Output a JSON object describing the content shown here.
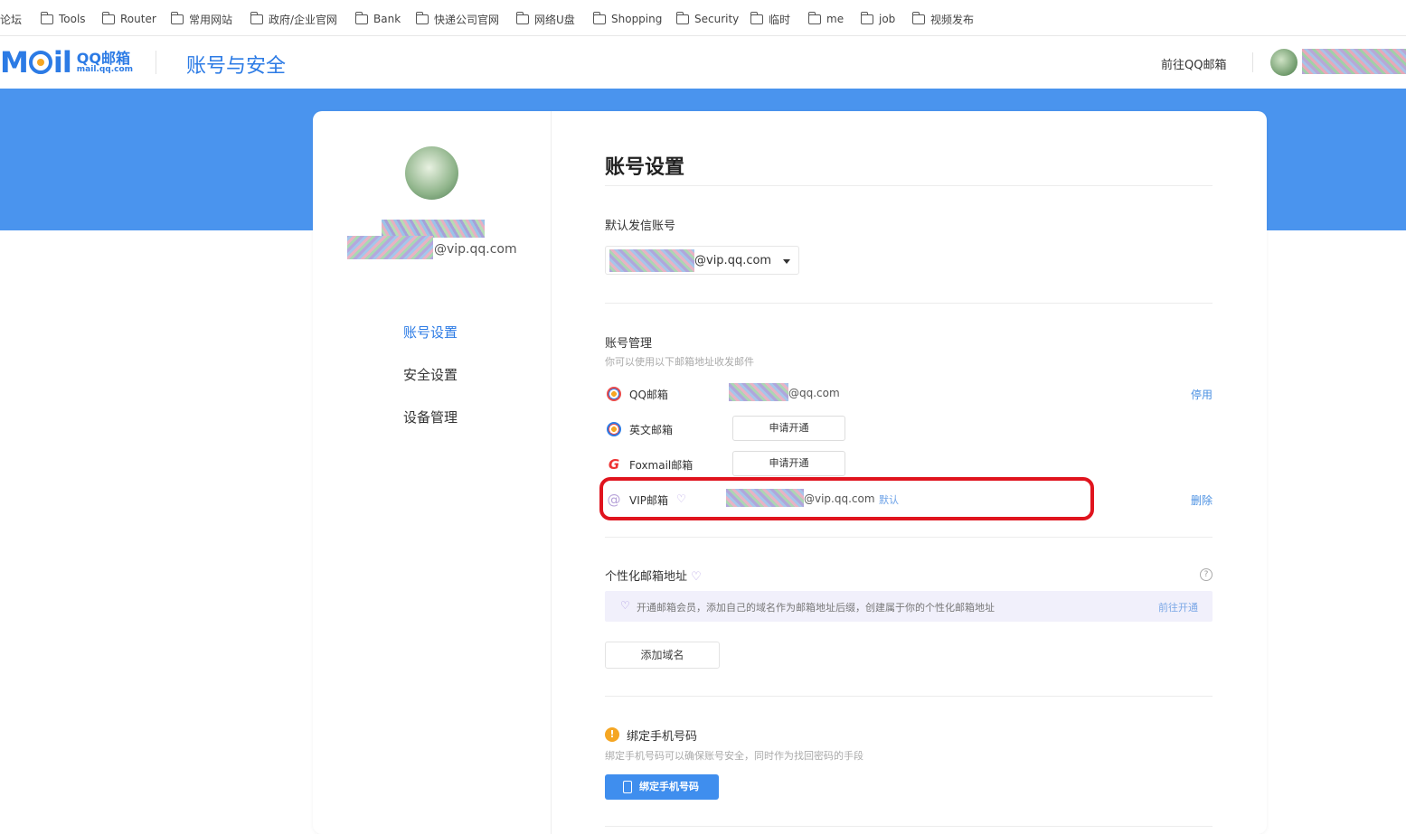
{
  "bookmarks": [
    {
      "label": "论坛"
    },
    {
      "label": "Tools"
    },
    {
      "label": "Router"
    },
    {
      "label": "常用网站"
    },
    {
      "label": "政府/企业官网"
    },
    {
      "label": "Bank"
    },
    {
      "label": "快递公司官网"
    },
    {
      "label": "网络U盘"
    },
    {
      "label": "Shopping"
    },
    {
      "label": "Security"
    },
    {
      "label": "临时"
    },
    {
      "label": "me"
    },
    {
      "label": "job"
    },
    {
      "label": "视频发布"
    }
  ],
  "header": {
    "logo_brand": "QQ邮箱",
    "logo_domain": "mail.qq.com",
    "section_title": "账号与安全",
    "goto_link": "前往QQ邮箱"
  },
  "sidebar": {
    "email_suffix": "@vip.qq.com",
    "items": [
      {
        "label": "账号设置",
        "active": true
      },
      {
        "label": "安全设置",
        "active": false
      },
      {
        "label": "设备管理",
        "active": false
      }
    ]
  },
  "main": {
    "title": "账号设置",
    "default_sender": {
      "label": "默认发信账号",
      "selected_value": "@vip.qq.com"
    },
    "account_management": {
      "label": "账号管理",
      "desc": "你可以使用以下邮箱地址收发邮件",
      "rows": [
        {
          "name": "QQ邮箱",
          "icon": "qq-mail-icon",
          "address": "@qq.com",
          "action": "停用"
        },
        {
          "name": "英文邮箱",
          "icon": "english-mail-icon",
          "button": "申请开通"
        },
        {
          "name": "Foxmail邮箱",
          "icon": "foxmail-icon",
          "button": "申请开通"
        },
        {
          "name": "VIP邮箱",
          "icon": "at-icon",
          "address": "@vip.qq.com",
          "tag": "默认",
          "action": "删除"
        }
      ]
    },
    "custom_address": {
      "label": "个性化邮箱地址",
      "promo_text": "开通邮箱会员，添加自己的域名作为邮箱地址后缀，创建属于你的个性化邮箱地址",
      "promo_link": "前往开通",
      "add_button": "添加域名"
    },
    "phone_binding": {
      "label": "绑定手机号码",
      "desc": "绑定手机号码可以确保账号安全，同时作为找回密码的手段",
      "button": "绑定手机号码"
    }
  },
  "colors": {
    "accent": "#2c7be5",
    "band": "#4a94ee",
    "highlight": "#e0141e",
    "warning": "#f5a623"
  }
}
